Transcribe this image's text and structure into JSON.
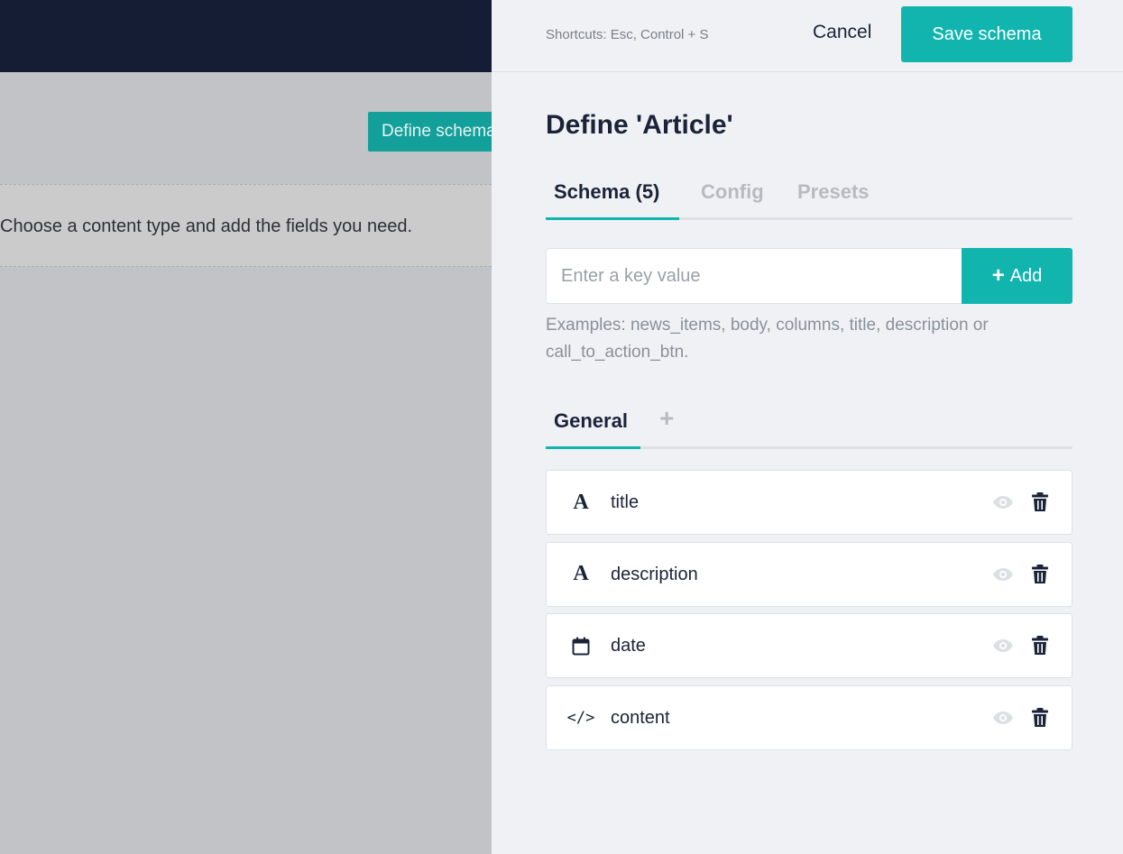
{
  "background": {
    "define_button_label": "Define schema",
    "notice_text": "Choose a content type and add the fields you need."
  },
  "header": {
    "shortcuts": "Shortcuts: Esc, Control + S",
    "cancel_label": "Cancel",
    "save_label": "Save schema"
  },
  "panel": {
    "title": "Define 'Article'",
    "tabs": [
      {
        "label": "Schema (5)",
        "active": true
      },
      {
        "label": "Config",
        "active": false
      },
      {
        "label": "Presets",
        "active": false
      }
    ]
  },
  "key_input": {
    "placeholder": "Enter a key value",
    "value": "",
    "add_label": "Add",
    "add_icon": "plus-icon"
  },
  "examples_text": "Examples: news_items, body, columns, title, description or call_to_action_btn.",
  "group_tabs": {
    "active": "General",
    "add_symbol": "+"
  },
  "fields": [
    {
      "name": "title",
      "type": "text",
      "type_symbol": "A",
      "icon": "text-type-icon"
    },
    {
      "name": "description",
      "type": "text",
      "type_symbol": "A",
      "icon": "text-type-icon"
    },
    {
      "name": "date",
      "type": "datetime",
      "type_symbol": "",
      "icon": "calendar-icon"
    },
    {
      "name": "content",
      "type": "markdown",
      "type_symbol": "</>",
      "icon": "code-icon"
    }
  ],
  "colors": {
    "accent": "#12b5ae",
    "dark": "#1b2338",
    "topbar": "#141d33",
    "panel_bg": "#eff1f5"
  }
}
